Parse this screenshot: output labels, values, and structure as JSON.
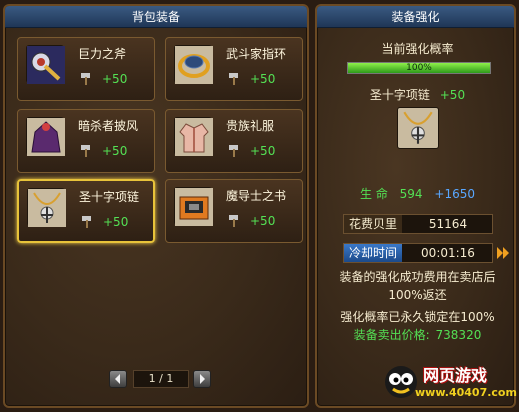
{
  "left_panel": {
    "title": "背包装备",
    "items": [
      {
        "name": "巨力之斧",
        "bonus": "+50",
        "icon": "axe-icon"
      },
      {
        "name": "武斗家指环",
        "bonus": "+50",
        "icon": "ring-icon"
      },
      {
        "name": "暗杀者披风",
        "bonus": "+50",
        "icon": "cloak-icon"
      },
      {
        "name": "贵族礼服",
        "bonus": "+50",
        "icon": "jacket-icon"
      },
      {
        "name": "圣十字项链",
        "bonus": "+50",
        "icon": "necklace-icon",
        "selected": true
      },
      {
        "name": "魔导士之书",
        "bonus": "+50",
        "icon": "book-icon"
      }
    ],
    "pager": {
      "page": "1 / 1"
    }
  },
  "right_panel": {
    "title": "装备强化",
    "rate_label": "当前强化概率",
    "rate_value": "100%",
    "rate_fraction": 1.0,
    "item_name": "圣十字项链",
    "item_bonus": "+50",
    "stat_label": "生 命",
    "stat_value": "594",
    "stat_bonus": "+1650",
    "cost_label": "花费贝里",
    "cost_value": "51164",
    "cooldown_label": "冷却时间",
    "cooldown_value": "00:01:16",
    "note_line1": "装备的强化成功费用在卖店后",
    "note_line2": "100%返还",
    "note_line3": "强化概率已永久锁定在100%",
    "sell_label": "装备卖出价格:",
    "sell_value": "738320",
    "watermark_text": "网页游戏",
    "watermark_url": "www.40407.com"
  },
  "colors": {
    "title_bar": "#2c4a70",
    "bonus_green": "#54e054",
    "stat_blue": "#59a7ff",
    "selected_border": "#e8c33a"
  }
}
